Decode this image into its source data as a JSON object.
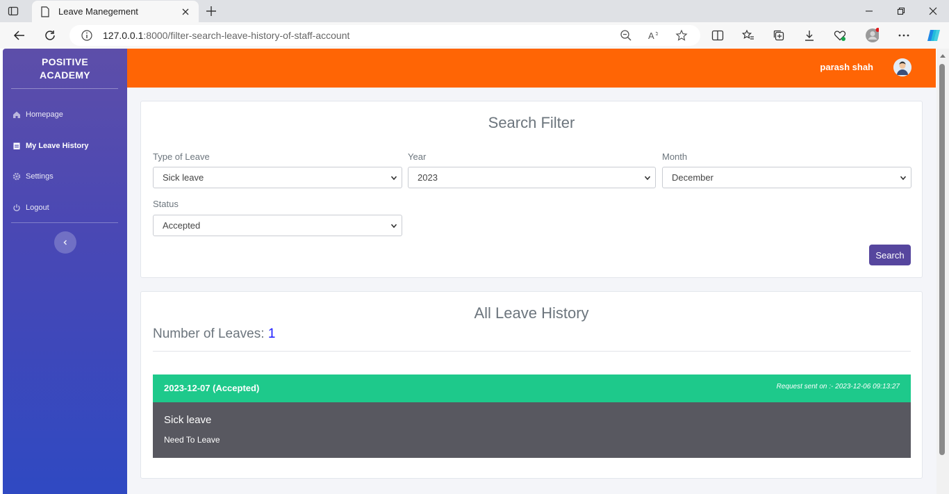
{
  "browser": {
    "tab_title": "Leave Manegement",
    "url_host": "127.0.0.1",
    "url_rest": ":8000/filter-search-leave-history-of-staff-account"
  },
  "sidebar": {
    "brand_line1": "POSITIVE",
    "brand_line2": "ACADEMY",
    "items": [
      {
        "label": "Homepage",
        "icon": "home-icon"
      },
      {
        "label": "My Leave History",
        "icon": "calendar-icon"
      },
      {
        "label": "Settings",
        "icon": "gear-icon"
      },
      {
        "label": "Logout",
        "icon": "power-icon"
      }
    ]
  },
  "header": {
    "username": "parash shah"
  },
  "filter": {
    "title": "Search Filter",
    "type_label": "Type of Leave",
    "type_value": "Sick leave",
    "year_label": "Year",
    "year_value": "2023",
    "month_label": "Month",
    "month_value": "December",
    "status_label": "Status",
    "status_value": "Accepted",
    "search_label": "Search"
  },
  "history": {
    "title": "All Leave History",
    "count_label": "Number of Leaves:",
    "count_value": "1",
    "entries": [
      {
        "date_status": "2023-12-07 (Accepted)",
        "sent": "Request sent on :- 2023-12-06 09:13:27",
        "type": "Sick leave",
        "reason": "Need To Leave"
      }
    ]
  },
  "colors": {
    "topbar": "#ff6505",
    "sidebar_top": "#5d4ea9",
    "sidebar_bottom": "#2f49c2",
    "accepted": "#1ec98b",
    "search_button": "#56469e"
  }
}
